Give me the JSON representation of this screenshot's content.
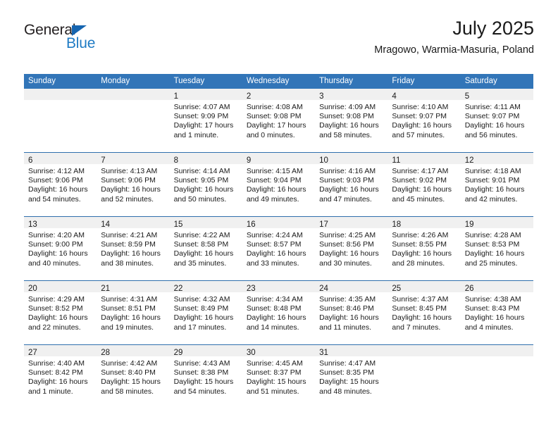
{
  "brand": {
    "name_part1": "General",
    "name_part2": "Blue",
    "triangle_icon": "triangle-icon",
    "accent_color": "#1f7bc4"
  },
  "header": {
    "title": "July 2025",
    "subtitle": "Mragowo, Warmia-Masuria, Poland"
  },
  "theme": {
    "header_blue": "#3275b8",
    "row_divider_blue": "#2f6fad",
    "day_strip_gray": "#f0f0f0"
  },
  "calendar": {
    "weekday_headers": [
      "Sunday",
      "Monday",
      "Tuesday",
      "Wednesday",
      "Thursday",
      "Friday",
      "Saturday"
    ],
    "weeks": [
      [
        {
          "day": "",
          "sunrise": "",
          "sunset": "",
          "daylight_line1": "",
          "daylight_line2": ""
        },
        {
          "day": "",
          "sunrise": "",
          "sunset": "",
          "daylight_line1": "",
          "daylight_line2": ""
        },
        {
          "day": "1",
          "sunrise": "Sunrise: 4:07 AM",
          "sunset": "Sunset: 9:09 PM",
          "daylight_line1": "Daylight: 17 hours",
          "daylight_line2": "and 1 minute."
        },
        {
          "day": "2",
          "sunrise": "Sunrise: 4:08 AM",
          "sunset": "Sunset: 9:08 PM",
          "daylight_line1": "Daylight: 17 hours",
          "daylight_line2": "and 0 minutes."
        },
        {
          "day": "3",
          "sunrise": "Sunrise: 4:09 AM",
          "sunset": "Sunset: 9:08 PM",
          "daylight_line1": "Daylight: 16 hours",
          "daylight_line2": "and 58 minutes."
        },
        {
          "day": "4",
          "sunrise": "Sunrise: 4:10 AM",
          "sunset": "Sunset: 9:07 PM",
          "daylight_line1": "Daylight: 16 hours",
          "daylight_line2": "and 57 minutes."
        },
        {
          "day": "5",
          "sunrise": "Sunrise: 4:11 AM",
          "sunset": "Sunset: 9:07 PM",
          "daylight_line1": "Daylight: 16 hours",
          "daylight_line2": "and 56 minutes."
        }
      ],
      [
        {
          "day": "6",
          "sunrise": "Sunrise: 4:12 AM",
          "sunset": "Sunset: 9:06 PM",
          "daylight_line1": "Daylight: 16 hours",
          "daylight_line2": "and 54 minutes."
        },
        {
          "day": "7",
          "sunrise": "Sunrise: 4:13 AM",
          "sunset": "Sunset: 9:06 PM",
          "daylight_line1": "Daylight: 16 hours",
          "daylight_line2": "and 52 minutes."
        },
        {
          "day": "8",
          "sunrise": "Sunrise: 4:14 AM",
          "sunset": "Sunset: 9:05 PM",
          "daylight_line1": "Daylight: 16 hours",
          "daylight_line2": "and 50 minutes."
        },
        {
          "day": "9",
          "sunrise": "Sunrise: 4:15 AM",
          "sunset": "Sunset: 9:04 PM",
          "daylight_line1": "Daylight: 16 hours",
          "daylight_line2": "and 49 minutes."
        },
        {
          "day": "10",
          "sunrise": "Sunrise: 4:16 AM",
          "sunset": "Sunset: 9:03 PM",
          "daylight_line1": "Daylight: 16 hours",
          "daylight_line2": "and 47 minutes."
        },
        {
          "day": "11",
          "sunrise": "Sunrise: 4:17 AM",
          "sunset": "Sunset: 9:02 PM",
          "daylight_line1": "Daylight: 16 hours",
          "daylight_line2": "and 45 minutes."
        },
        {
          "day": "12",
          "sunrise": "Sunrise: 4:18 AM",
          "sunset": "Sunset: 9:01 PM",
          "daylight_line1": "Daylight: 16 hours",
          "daylight_line2": "and 42 minutes."
        }
      ],
      [
        {
          "day": "13",
          "sunrise": "Sunrise: 4:20 AM",
          "sunset": "Sunset: 9:00 PM",
          "daylight_line1": "Daylight: 16 hours",
          "daylight_line2": "and 40 minutes."
        },
        {
          "day": "14",
          "sunrise": "Sunrise: 4:21 AM",
          "sunset": "Sunset: 8:59 PM",
          "daylight_line1": "Daylight: 16 hours",
          "daylight_line2": "and 38 minutes."
        },
        {
          "day": "15",
          "sunrise": "Sunrise: 4:22 AM",
          "sunset": "Sunset: 8:58 PM",
          "daylight_line1": "Daylight: 16 hours",
          "daylight_line2": "and 35 minutes."
        },
        {
          "day": "16",
          "sunrise": "Sunrise: 4:24 AM",
          "sunset": "Sunset: 8:57 PM",
          "daylight_line1": "Daylight: 16 hours",
          "daylight_line2": "and 33 minutes."
        },
        {
          "day": "17",
          "sunrise": "Sunrise: 4:25 AM",
          "sunset": "Sunset: 8:56 PM",
          "daylight_line1": "Daylight: 16 hours",
          "daylight_line2": "and 30 minutes."
        },
        {
          "day": "18",
          "sunrise": "Sunrise: 4:26 AM",
          "sunset": "Sunset: 8:55 PM",
          "daylight_line1": "Daylight: 16 hours",
          "daylight_line2": "and 28 minutes."
        },
        {
          "day": "19",
          "sunrise": "Sunrise: 4:28 AM",
          "sunset": "Sunset: 8:53 PM",
          "daylight_line1": "Daylight: 16 hours",
          "daylight_line2": "and 25 minutes."
        }
      ],
      [
        {
          "day": "20",
          "sunrise": "Sunrise: 4:29 AM",
          "sunset": "Sunset: 8:52 PM",
          "daylight_line1": "Daylight: 16 hours",
          "daylight_line2": "and 22 minutes."
        },
        {
          "day": "21",
          "sunrise": "Sunrise: 4:31 AM",
          "sunset": "Sunset: 8:51 PM",
          "daylight_line1": "Daylight: 16 hours",
          "daylight_line2": "and 19 minutes."
        },
        {
          "day": "22",
          "sunrise": "Sunrise: 4:32 AM",
          "sunset": "Sunset: 8:49 PM",
          "daylight_line1": "Daylight: 16 hours",
          "daylight_line2": "and 17 minutes."
        },
        {
          "day": "23",
          "sunrise": "Sunrise: 4:34 AM",
          "sunset": "Sunset: 8:48 PM",
          "daylight_line1": "Daylight: 16 hours",
          "daylight_line2": "and 14 minutes."
        },
        {
          "day": "24",
          "sunrise": "Sunrise: 4:35 AM",
          "sunset": "Sunset: 8:46 PM",
          "daylight_line1": "Daylight: 16 hours",
          "daylight_line2": "and 11 minutes."
        },
        {
          "day": "25",
          "sunrise": "Sunrise: 4:37 AM",
          "sunset": "Sunset: 8:45 PM",
          "daylight_line1": "Daylight: 16 hours",
          "daylight_line2": "and 7 minutes."
        },
        {
          "day": "26",
          "sunrise": "Sunrise: 4:38 AM",
          "sunset": "Sunset: 8:43 PM",
          "daylight_line1": "Daylight: 16 hours",
          "daylight_line2": "and 4 minutes."
        }
      ],
      [
        {
          "day": "27",
          "sunrise": "Sunrise: 4:40 AM",
          "sunset": "Sunset: 8:42 PM",
          "daylight_line1": "Daylight: 16 hours",
          "daylight_line2": "and 1 minute."
        },
        {
          "day": "28",
          "sunrise": "Sunrise: 4:42 AM",
          "sunset": "Sunset: 8:40 PM",
          "daylight_line1": "Daylight: 15 hours",
          "daylight_line2": "and 58 minutes."
        },
        {
          "day": "29",
          "sunrise": "Sunrise: 4:43 AM",
          "sunset": "Sunset: 8:38 PM",
          "daylight_line1": "Daylight: 15 hours",
          "daylight_line2": "and 54 minutes."
        },
        {
          "day": "30",
          "sunrise": "Sunrise: 4:45 AM",
          "sunset": "Sunset: 8:37 PM",
          "daylight_line1": "Daylight: 15 hours",
          "daylight_line2": "and 51 minutes."
        },
        {
          "day": "31",
          "sunrise": "Sunrise: 4:47 AM",
          "sunset": "Sunset: 8:35 PM",
          "daylight_line1": "Daylight: 15 hours",
          "daylight_line2": "and 48 minutes."
        },
        {
          "day": "",
          "sunrise": "",
          "sunset": "",
          "daylight_line1": "",
          "daylight_line2": ""
        },
        {
          "day": "",
          "sunrise": "",
          "sunset": "",
          "daylight_line1": "",
          "daylight_line2": ""
        }
      ]
    ]
  }
}
